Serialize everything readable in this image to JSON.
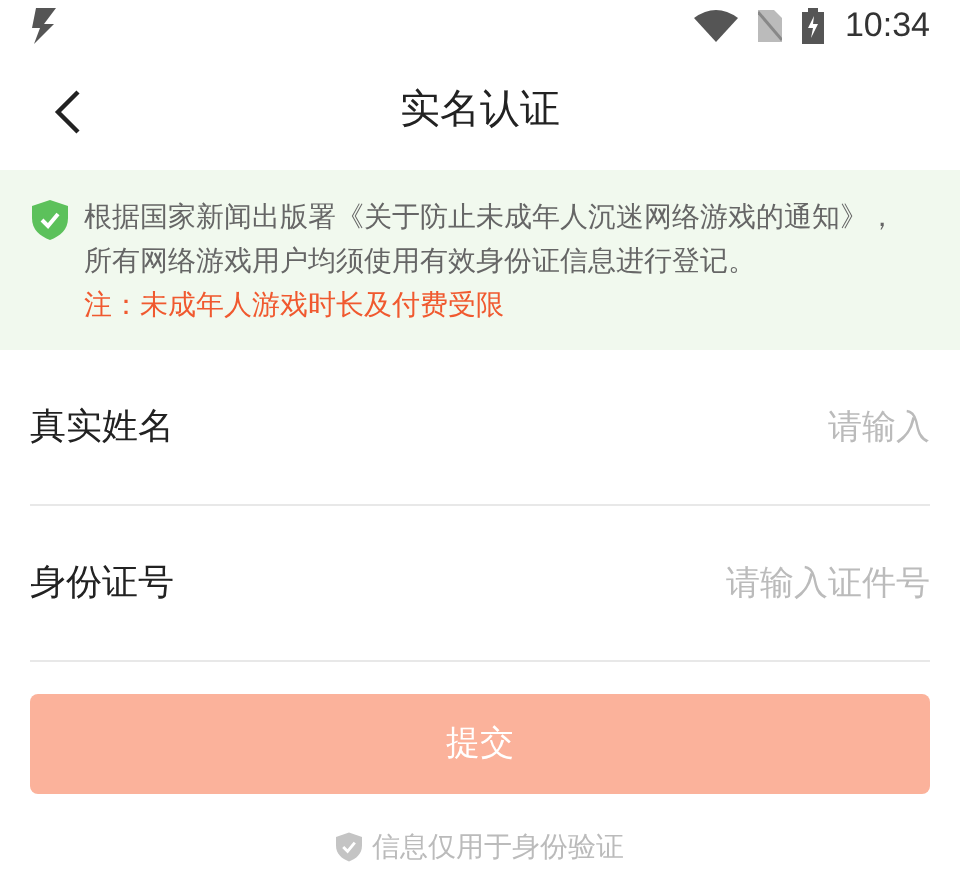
{
  "status_bar": {
    "time": "10:34"
  },
  "header": {
    "title": "实名认证"
  },
  "notice": {
    "text": "根据国家新闻出版署《关于防止未成年人沉迷网络游戏的通知》，所有网络游戏用户均须使用有效身份证信息进行登记。",
    "warning": "注：未成年人游戏时长及付费受限"
  },
  "fields": [
    {
      "label": "真实姓名",
      "placeholder": "请输入"
    },
    {
      "label": "身份证号",
      "placeholder": "请输入证件号"
    }
  ],
  "submit": {
    "label": "提交",
    "disabled": true
  },
  "footer": {
    "text": "信息仅用于身份验证"
  }
}
